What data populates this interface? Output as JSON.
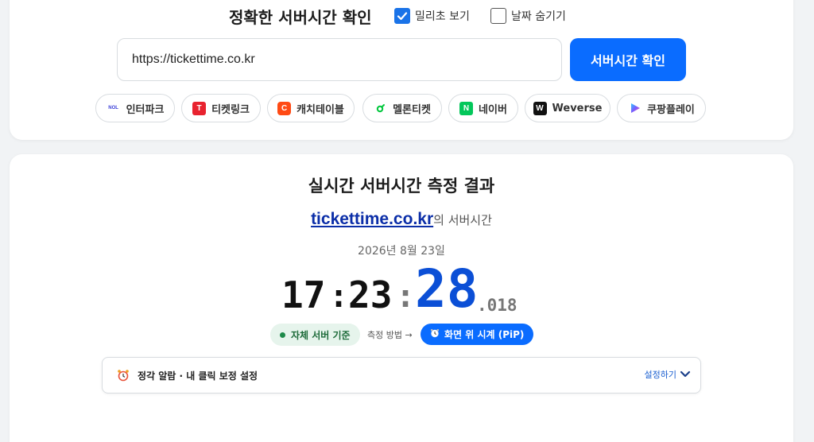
{
  "top": {
    "title": "정확한 서버시간 확인",
    "checkbox_ms": {
      "label": "밀리초 보기",
      "checked": true
    },
    "checkbox_hide_date": {
      "label": "날짜 숨기기",
      "checked": false
    },
    "url_input": {
      "value": "https://tickettime.co.kr"
    },
    "check_button": "서버시간 확인",
    "sites": [
      {
        "label": "인터파크",
        "icon": "nol-icon"
      },
      {
        "label": "티켓링크",
        "icon": "ticketlink-icon"
      },
      {
        "label": "캐치테이블",
        "icon": "catchtable-icon"
      },
      {
        "label": "멜론티켓",
        "icon": "melon-icon"
      },
      {
        "label": "네이버",
        "icon": "naver-icon"
      },
      {
        "label": "Weverse",
        "icon": "weverse-icon"
      },
      {
        "label": "쿠팡플레이",
        "icon": "coupangplay-icon"
      }
    ],
    "site_icon_text": {
      "nol": "NOL",
      "ticketlink": "T",
      "catchtable": "C",
      "naver": "N",
      "weverse": "W"
    }
  },
  "result": {
    "title": "실시간 서버시간 측정 결과",
    "host": "tickettime.co.kr",
    "host_suffix": "의 서버시간",
    "date": "2026년 8월 23일",
    "clock": {
      "hours": "17",
      "sep1": ":",
      "minutes": "23",
      "sep2": ":",
      "seconds": "28",
      "millis": ".018"
    },
    "server_badge": "자체 서버 기준",
    "method_label": "측정 방법 →",
    "pip_button": "화면 위 시계 (PiP)",
    "alarm": {
      "title": "정각 알람 · 내 클릭 보정 설정",
      "toggle": "설정하기"
    }
  },
  "colors": {
    "accent": "#0a6cff",
    "seconds": "#0b4fd6",
    "host": "#0b2ea8",
    "badge_bg": "#e6f4ec",
    "badge_text": "#1e6b3a"
  }
}
